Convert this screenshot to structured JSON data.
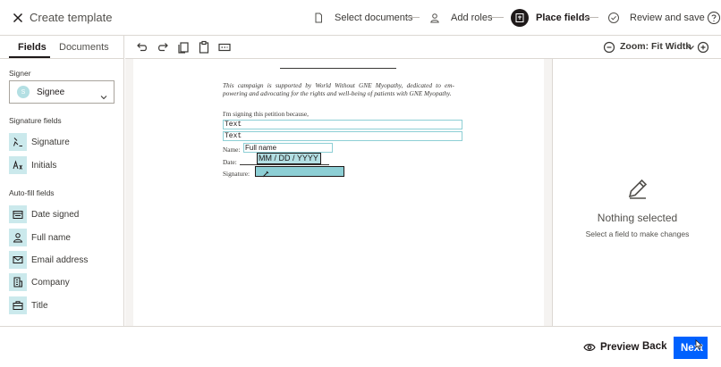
{
  "header": {
    "title": "Create template",
    "steps": [
      {
        "label": "Select documents"
      },
      {
        "label": "Add roles"
      },
      {
        "label": "Place fields"
      },
      {
        "label": "Review and save"
      }
    ]
  },
  "left_panel": {
    "tabs": [
      {
        "label": "Fields"
      },
      {
        "label": "Documents"
      }
    ],
    "signer_label": "Signer",
    "signer": {
      "initial": "S",
      "name": "Signee"
    },
    "signature_fields_label": "Signature fields",
    "signature_fields": [
      {
        "label": "Signature"
      },
      {
        "label": "Initials"
      }
    ],
    "autofill_label": "Auto-fill fields",
    "autofill_fields": [
      {
        "label": "Date signed"
      },
      {
        "label": "Full name"
      },
      {
        "label": "Email address"
      },
      {
        "label": "Company"
      },
      {
        "label": "Title"
      }
    ]
  },
  "toolbar": {
    "zoom_label": "Zoom: Fit Width"
  },
  "document": {
    "intro": "This campaign is supported by World Without GNE Myopathy, dedicated to em-powering and advocating for the rights and well-being of patients with GNE Myopathy.",
    "reason": "I'm signing this petition because,",
    "text_field_1": "Text",
    "text_field_2": "Text",
    "name_label": "Name:",
    "name_field": "Full name",
    "date_label": "Date:",
    "date_field": "MM / DD / YYYY",
    "signature_label": "Signature:"
  },
  "right_panel": {
    "title": "Nothing selected",
    "subtitle": "Select a field to make changes"
  },
  "footer": {
    "preview_label": "Preview",
    "back_label": "Back",
    "next_label": "Next"
  },
  "colors": {
    "accent": "#0061fe",
    "field_fill": "#b3dfe3",
    "field_border": "#8dcfd5"
  }
}
